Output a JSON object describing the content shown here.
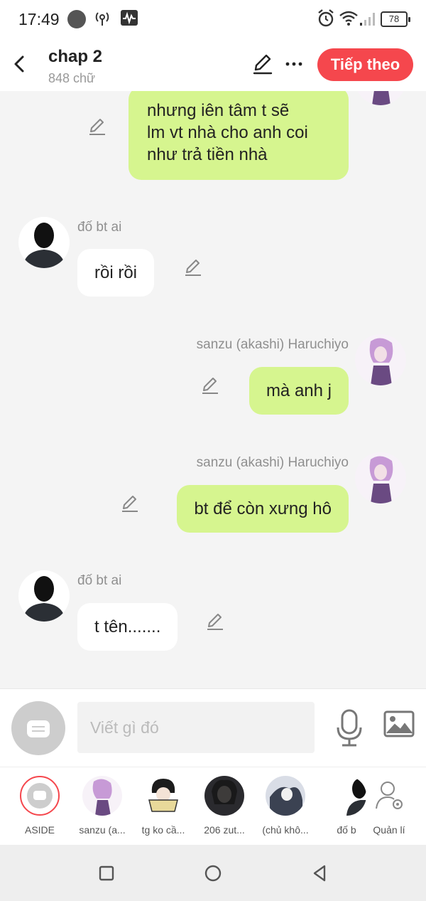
{
  "status_bar": {
    "time": "17:49",
    "battery": "78",
    "icons": [
      "notification-dot-icon",
      "hotspot-icon",
      "activity-icon",
      "alarm-icon",
      "wifi-icon",
      "signal-icon",
      "battery-icon"
    ]
  },
  "header": {
    "title": "chap 2",
    "word_count": "848 chữ",
    "next_label": "Tiếp theo",
    "icons": [
      "back-icon",
      "edit-icon",
      "more-icon"
    ]
  },
  "messages": [
    {
      "side": "right",
      "sender": "",
      "lines": [
        "nhưng iên tâm t sẽ",
        "lm vt nhà cho anh coi",
        "như trả tiền nhà"
      ]
    },
    {
      "side": "left",
      "sender": "đố bt ai",
      "lines": [
        "rồi rồi"
      ]
    },
    {
      "side": "right",
      "sender": "sanzu (akashi) Haruchiyo",
      "lines": [
        "mà anh j"
      ]
    },
    {
      "side": "right",
      "sender": "sanzu (akashi) Haruchiyo",
      "lines": [
        "bt để còn xưng hô"
      ]
    },
    {
      "side": "left",
      "sender": "đố bt ai",
      "lines": [
        "t tên......."
      ]
    }
  ],
  "input": {
    "placeholder": "Viết gì đó",
    "icons": [
      "aside-toggle-icon",
      "microphone-icon",
      "image-icon"
    ]
  },
  "characters": [
    {
      "label": "ASIDE"
    },
    {
      "label": "sanzu (a..."
    },
    {
      "label": "tg ko cầ..."
    },
    {
      "label": "206 zut..."
    },
    {
      "label": "(chủ khô..."
    },
    {
      "label": "đố b"
    },
    {
      "label": "Quản lí"
    }
  ],
  "colors": {
    "accent": "#f5474d",
    "right_bubble": "#d6f58f",
    "left_bubble": "#ffffff",
    "background": "#f4f4f4"
  },
  "nav_icons": [
    "recent-apps-icon",
    "home-icon",
    "back-nav-icon"
  ]
}
